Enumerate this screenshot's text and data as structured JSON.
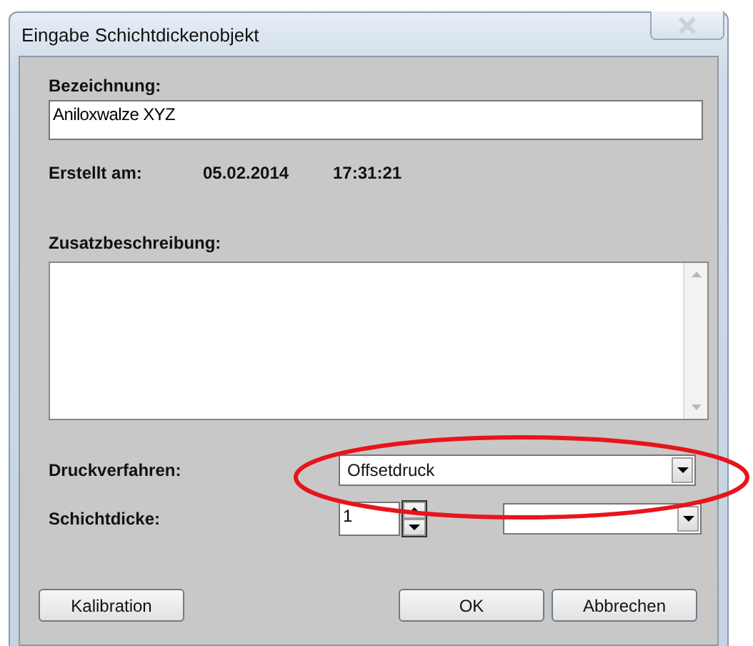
{
  "window": {
    "title": "Eingabe Schichtdickenobjekt"
  },
  "name_field": {
    "label": "Bezeichnung:",
    "value": "Aniloxwalze XYZ"
  },
  "created": {
    "label": "Erstellt am:",
    "date": "05.02.2014",
    "time": "17:31:21"
  },
  "description": {
    "label": "Zusatzbeschreibung:"
  },
  "print_process": {
    "label": "Druckverfahren:",
    "value": "Offsetdruck",
    "highlighted": true
  },
  "layer_thickness": {
    "label": "Schichtdicke:",
    "value": "1"
  },
  "buttons": [
    {
      "label": "Kalibration",
      "kind": "left"
    },
    {
      "label": "OK",
      "kind": "right"
    },
    {
      "label": "Abbrechen",
      "kind": "right"
    }
  ]
}
